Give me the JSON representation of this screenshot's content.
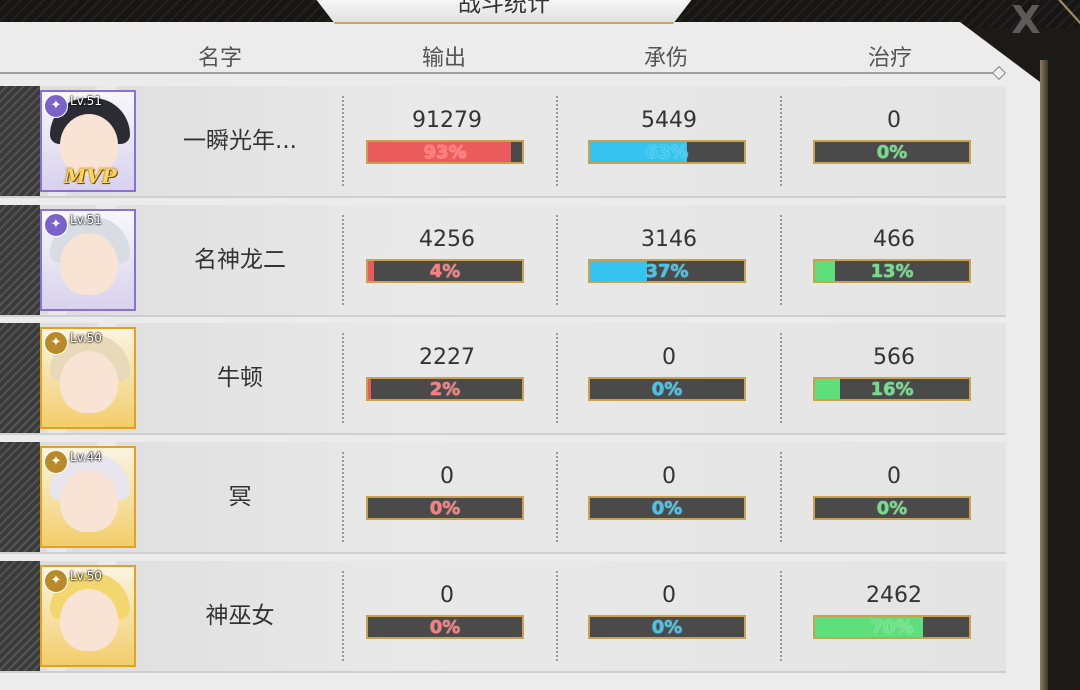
{
  "window": {
    "title": "战斗统计",
    "close_label": "X"
  },
  "headers": [
    "名字",
    "输出",
    "承伤",
    "治疗"
  ],
  "colors": {
    "output": "#ec5b5b",
    "tank": "#35c3ef",
    "heal": "#5de07b",
    "bar_border": "#c8a24e"
  },
  "mvp_label": "MVP",
  "players": [
    {
      "name": "一瞬光年...",
      "level": "Lv.51",
      "class_icon": "archer-icon",
      "frame": "purple",
      "mvp": true,
      "output": {
        "value": "91279",
        "pct": "93%",
        "ratio": 0.93
      },
      "tank": {
        "value": "5449",
        "pct": "63%",
        "ratio": 0.63
      },
      "heal": {
        "value": "0",
        "pct": "0%",
        "ratio": 0
      }
    },
    {
      "name": "名神龙二",
      "level": "Lv.51",
      "class_icon": "shield-icon",
      "frame": "purple",
      "mvp": false,
      "output": {
        "value": "4256",
        "pct": "4%",
        "ratio": 0.04
      },
      "tank": {
        "value": "3146",
        "pct": "37%",
        "ratio": 0.37
      },
      "heal": {
        "value": "466",
        "pct": "13%",
        "ratio": 0.13
      }
    },
    {
      "name": "牛顿",
      "level": "Lv.50",
      "class_icon": "mage-icon",
      "frame": "gold",
      "mvp": false,
      "output": {
        "value": "2227",
        "pct": "2%",
        "ratio": 0.02
      },
      "tank": {
        "value": "0",
        "pct": "0%",
        "ratio": 0
      },
      "heal": {
        "value": "566",
        "pct": "16%",
        "ratio": 0.16
      }
    },
    {
      "name": "冥",
      "level": "Lv.44",
      "class_icon": "bow-icon",
      "frame": "gold",
      "mvp": false,
      "output": {
        "value": "0",
        "pct": "0%",
        "ratio": 0
      },
      "tank": {
        "value": "0",
        "pct": "0%",
        "ratio": 0
      },
      "heal": {
        "value": "0",
        "pct": "0%",
        "ratio": 0
      }
    },
    {
      "name": "神巫女",
      "level": "Lv.50",
      "class_icon": "healer-icon",
      "frame": "gold",
      "mvp": false,
      "output": {
        "value": "0",
        "pct": "0%",
        "ratio": 0
      },
      "tank": {
        "value": "0",
        "pct": "0%",
        "ratio": 0
      },
      "heal": {
        "value": "2462",
        "pct": "70%",
        "ratio": 0.7
      }
    }
  ]
}
